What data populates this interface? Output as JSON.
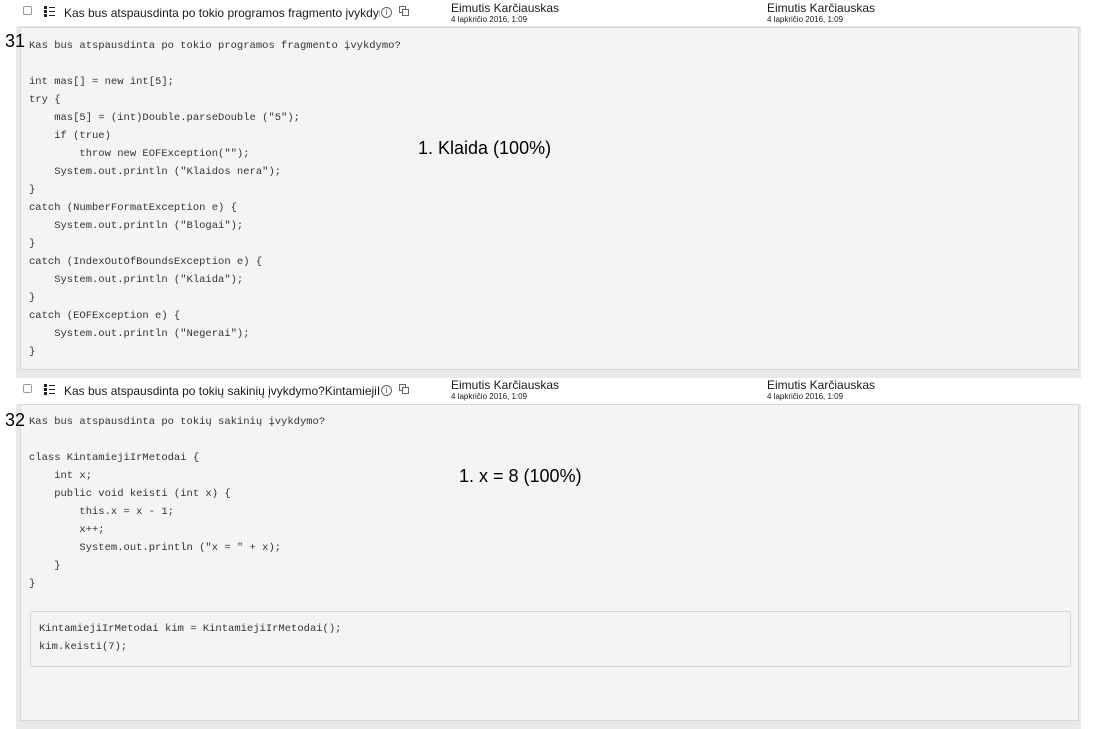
{
  "questions": [
    {
      "number": "31",
      "name": "Kas bus atspausdinta po tokio programos fragmento įvykdymo?",
      "created_by": "Eimutis Karčiauskas",
      "created_date": "4 lapkričio 2016, 1:09",
      "modified_by": "Eimutis Karčiauskas",
      "modified_date": "4 lapkričio 2016, 1:09",
      "code": "Kas bus atspausdinta po tokio programos fragmento įvykdymo?\n\nint mas[] = new int[5];\ntry {\n    mas[5] = (int)Double.parseDouble (\"5\");\n    if (true)\n        throw new EOFException(\"\");\n    System.out.println (\"Klaidos nera\");\n}\ncatch (NumberFormatException e) {\n    System.out.println (\"Blogai\");\n}\ncatch (IndexOutOfBoundsException e) {\n    System.out.println (\"Klaida\");\n}\ncatch (EOFException e) {\n    System.out.println (\"Negerai\");\n}",
      "answer": "1. Klaida (100%)"
    },
    {
      "number": "32",
      "name": "Kas bus atspausdinta po tokių sakinių įvykdymo?KintamiejiIrMetodai",
      "created_by": "Eimutis Karčiauskas",
      "created_date": "4 lapkričio 2016, 1:09",
      "modified_by": "Eimutis Karčiauskas",
      "modified_date": "4 lapkričio 2016, 1:09",
      "code": "Kas bus atspausdinta po tokių sakinių įvykdymo?\n\nclass KintamiejiIrMetodai {\n    int x;\n    public void keisti (int x) {\n        this.x = x - 1;\n        x++;\n        System.out.println (\"x = \" + x);\n    }\n}",
      "code_box": "KintamiejiIrMetodai kim = KintamiejiIrMetodai();\nkim.keisti(7);",
      "answer": "1. x = 8 (100%)"
    }
  ]
}
